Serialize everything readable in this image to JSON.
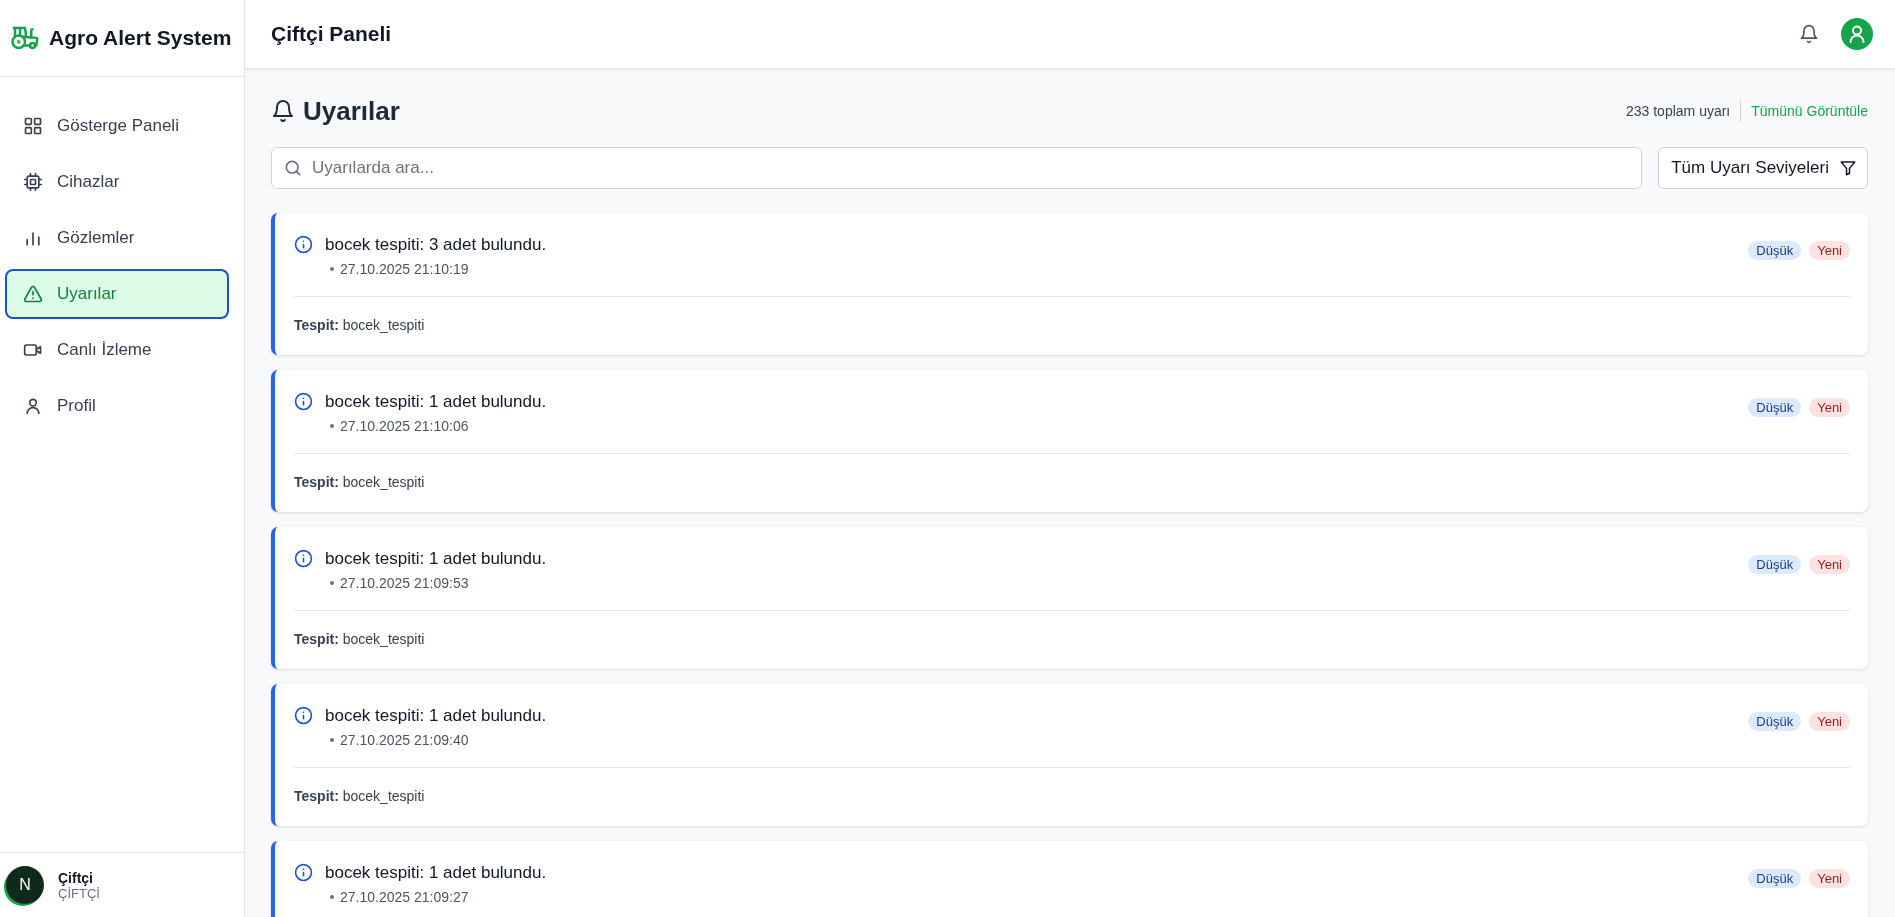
{
  "sidebar": {
    "app_name": "Agro Alert System",
    "items": [
      {
        "label": "Gösterge Paneli",
        "kind": "grid",
        "selected": false
      },
      {
        "label": "Cihazlar",
        "kind": "chip",
        "selected": false
      },
      {
        "label": "Gözlemler",
        "kind": "bars",
        "selected": false
      },
      {
        "label": "Uyarılar",
        "kind": "warning",
        "selected": true
      },
      {
        "label": "Canlı İzleme",
        "kind": "video",
        "selected": false
      },
      {
        "label": "Profil",
        "kind": "user",
        "selected": false
      }
    ],
    "user": {
      "avatar_letter": "N",
      "name": "Çiftçi",
      "role": "ÇİFTÇİ"
    }
  },
  "header": {
    "title": "Çiftçi Paneli"
  },
  "page": {
    "title": "Uyarılar",
    "total": "233 toplam uyarı",
    "view_all": "Tümünü Görüntüle",
    "search": {
      "placeholder": "Uyarılarda ara..."
    },
    "filter": "Tüm Uyarı Seviyeleri"
  },
  "alerts": [
    {
      "message": "bocek tespiti: 3 adet bulundu.",
      "time": "27.10.2025 21:10:19",
      "severity": {
        "label": "Düşük",
        "kind": "low"
      },
      "status": {
        "label": "Yeni",
        "kind": "new"
      },
      "detail": "**Tespit:** bocek_tespiti"
    },
    {
      "message": "bocek tespiti: 1 adet bulundu.",
      "time": "27.10.2025 21:10:06",
      "severity": {
        "label": "Düşük",
        "kind": "low"
      },
      "status": {
        "label": "Yeni",
        "kind": "new"
      },
      "detail": "**Tespit:** bocek_tespiti"
    },
    {
      "message": "bocek tespiti: 1 adet bulundu.",
      "time": "27.10.2025 21:09:53",
      "severity": {
        "label": "Düşük",
        "kind": "low"
      },
      "status": {
        "label": "Yeni",
        "kind": "new"
      },
      "detail": "**Tespit:** bocek_tespiti"
    },
    {
      "message": "bocek tespiti: 1 adet bulundu.",
      "time": "27.10.2025 21:09:40",
      "severity": {
        "label": "Düşük",
        "kind": "low"
      },
      "status": {
        "label": "Yeni",
        "kind": "new"
      },
      "detail": "**Tespit:** bocek_tespiti"
    },
    {
      "message": "bocek tespiti: 1 adet bulundu.",
      "time": "27.10.2025 21:09:27",
      "severity": {
        "label": "Düşük",
        "kind": "low"
      },
      "status": {
        "label": "Yeni",
        "kind": "new"
      }
    }
  ]
}
